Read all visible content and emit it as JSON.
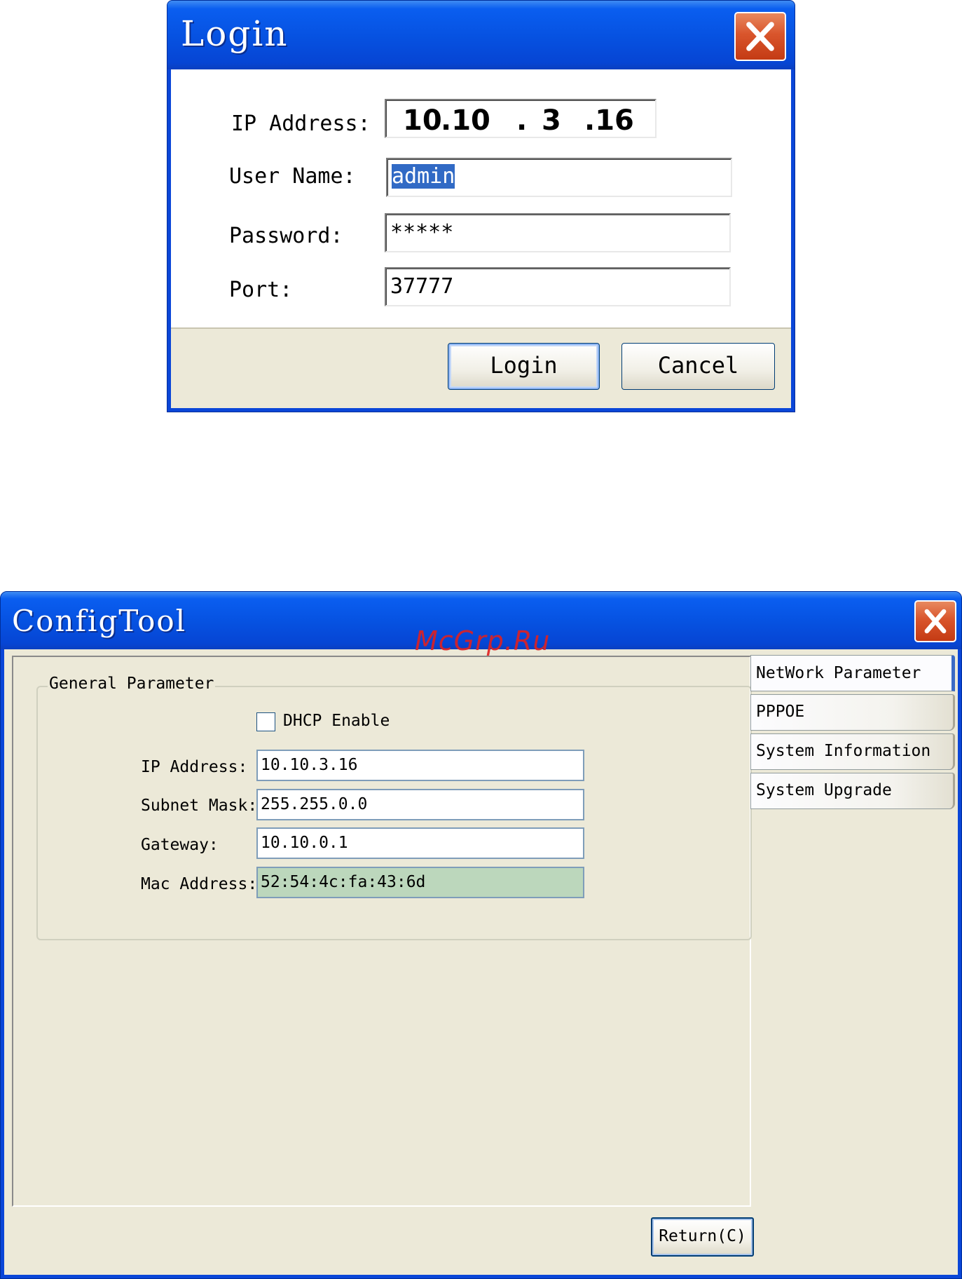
{
  "login": {
    "title": "Login",
    "labels": {
      "ip": "IP Address:",
      "user": "User Name:",
      "password": "Password:",
      "port": "Port:"
    },
    "ip_parts": [
      "10",
      ".10",
      ".",
      "3",
      ".16"
    ],
    "user_name": "admin",
    "password": "*****",
    "port": "37777",
    "login_button": "Login",
    "cancel_button": "Cancel"
  },
  "config": {
    "title": "ConfigTool",
    "watermark": "McGrp.Ru",
    "group_title": "General Parameter",
    "dhcp_label": "DHCP Enable",
    "dhcp_checked": false,
    "fields": {
      "ip_label": "IP Address:",
      "ip_value": "10.10.3.16",
      "subnet_label": "Subnet Mask:",
      "subnet_value": "255.255.0.0",
      "gateway_label": "Gateway:",
      "gateway_value": "10.10.0.1",
      "mac_label": "Mac Address:",
      "mac_value": "52:54:4c:fa:43:6d"
    },
    "tabs": [
      "NetWork Parameter",
      "PPPOE",
      "System Information",
      "System Upgrade"
    ],
    "return_button": "Return(C)"
  },
  "icons": {
    "close": "close-x-icon"
  },
  "colors": {
    "titlebar": "#0651e0",
    "close_button": "#d9552c",
    "client": "#ece9d8",
    "selection": "#316ac5",
    "mac_field": "#bcd7bc",
    "watermark": "#e02020"
  }
}
